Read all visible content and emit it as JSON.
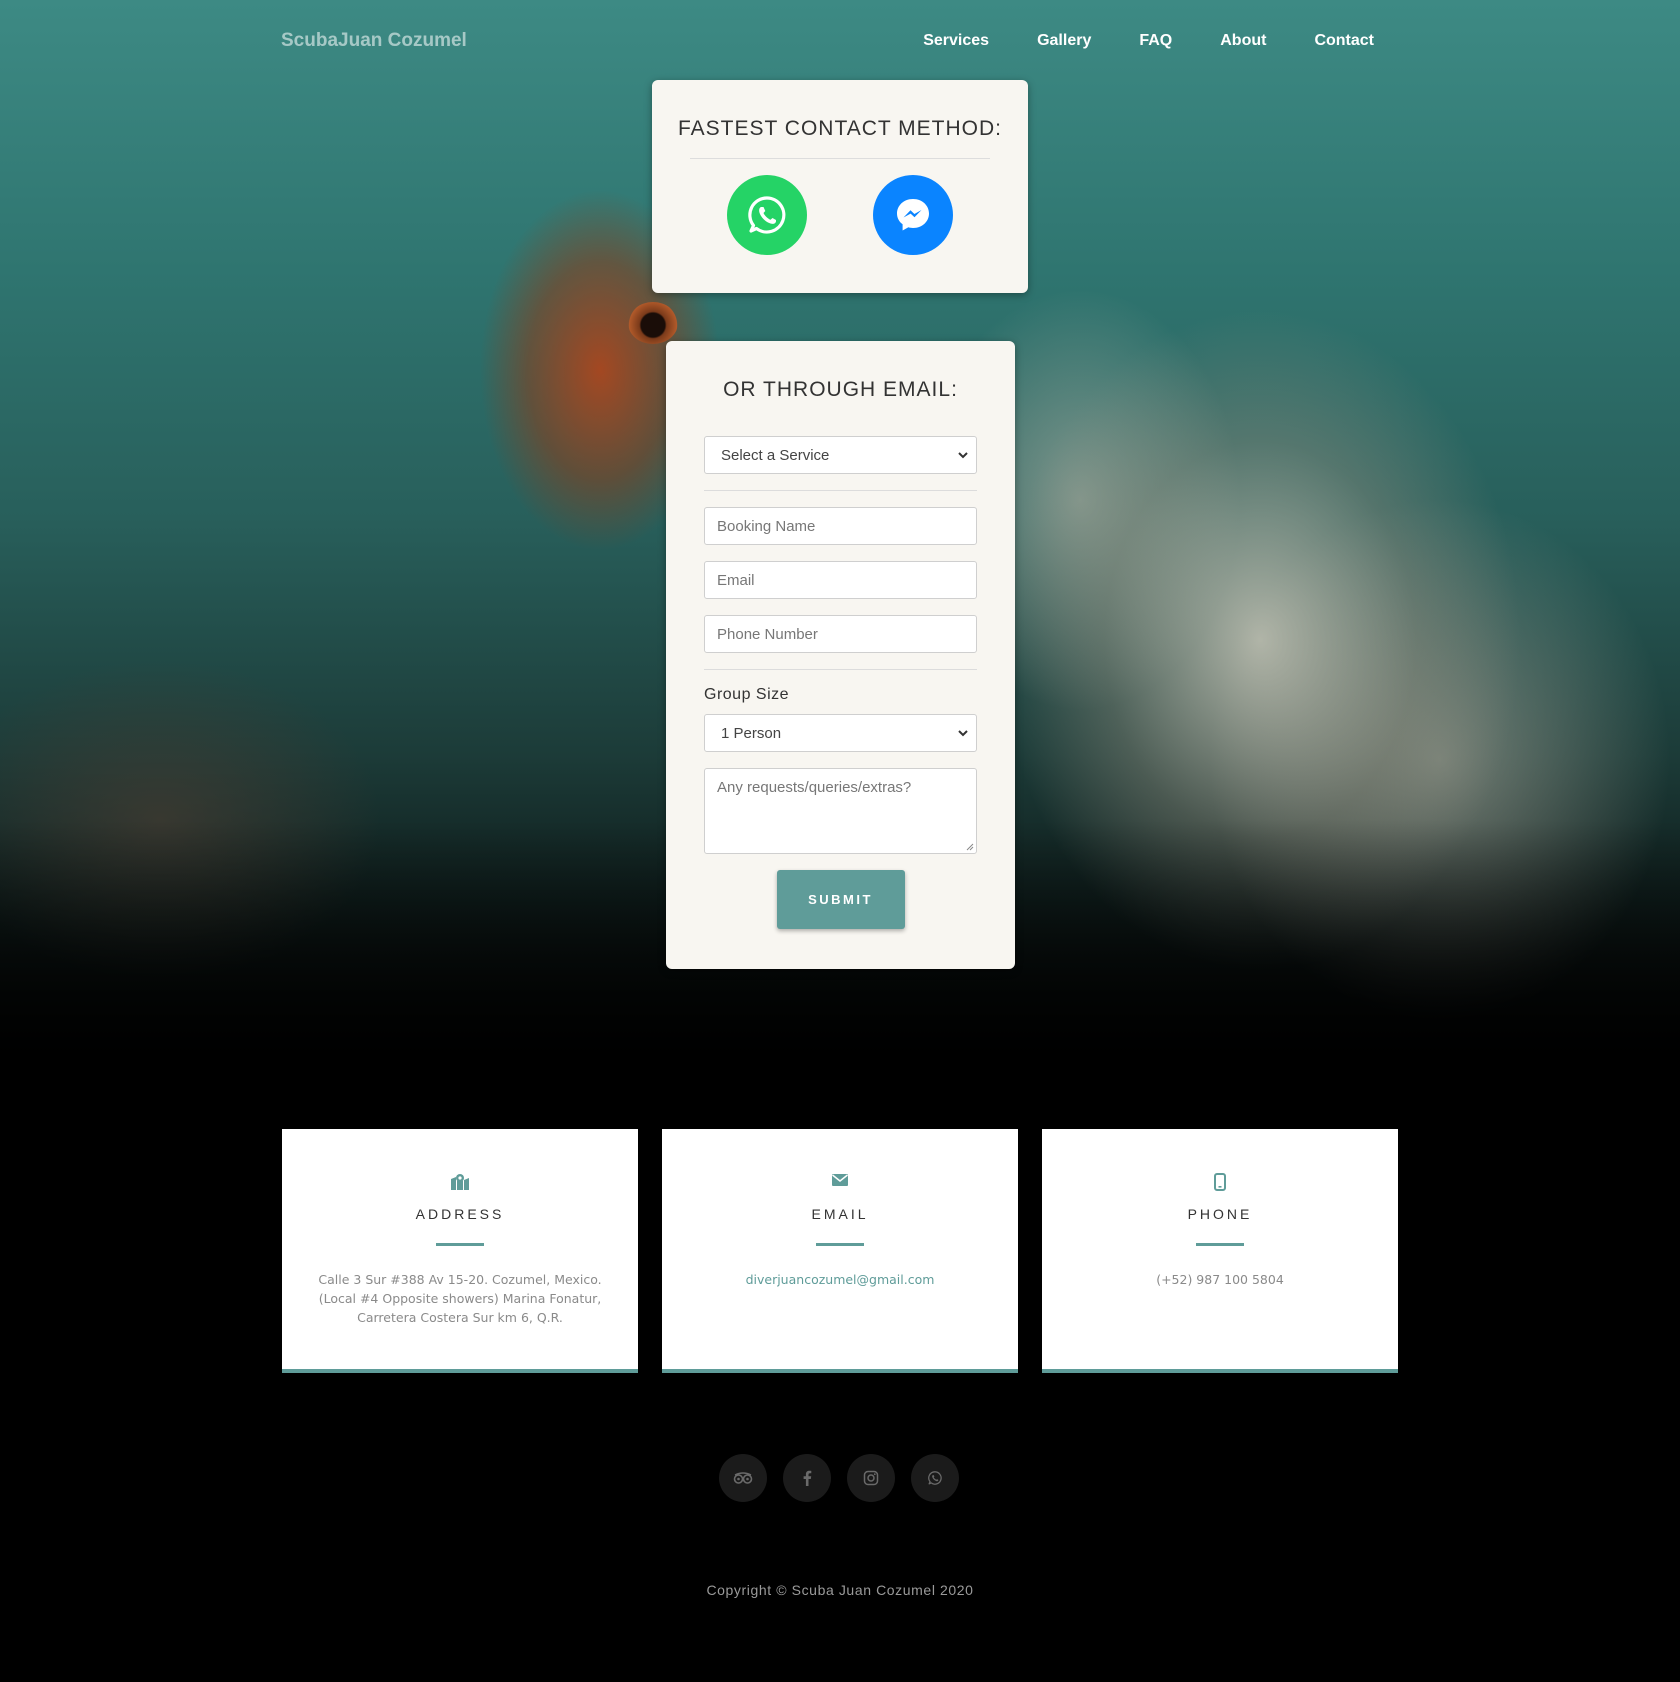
{
  "nav": {
    "brand": "ScubaJuan Cozumel",
    "links": [
      "Services",
      "Gallery",
      "FAQ",
      "About",
      "Contact"
    ]
  },
  "fastest": {
    "title": "FASTEST CONTACT METHOD:",
    "icons": [
      "whatsapp-icon",
      "messenger-icon"
    ]
  },
  "email_form": {
    "title": "OR THROUGH EMAIL:",
    "service_select": "Select a Service",
    "booking_name_placeholder": "Booking Name",
    "email_placeholder": "Email",
    "phone_placeholder": "Phone Number",
    "group_size_label": "Group Size",
    "group_size_value": "1 Person",
    "requests_placeholder": "Any requests/queries/extras?",
    "submit_label": "SUBMIT"
  },
  "info": {
    "address": {
      "icon": "map-icon",
      "heading": "ADDRESS",
      "text": "Calle 3 Sur #388 Av 15-20. Cozumel, Mexico. (Local #4 Opposite showers) Marina Fonatur, Carretera Costera Sur km 6, Q.R."
    },
    "email": {
      "icon": "envelope-icon",
      "heading": "EMAIL",
      "text": "diverjuancozumel@gmail.com"
    },
    "phone": {
      "icon": "mobile-phone-icon",
      "heading": "PHONE",
      "text": "(+52) 987 100 5804"
    }
  },
  "social": [
    "tripadvisor-icon",
    "facebook-icon",
    "instagram-icon",
    "whatsapp-icon"
  ],
  "footer": {
    "copyright": "Copyright © Scuba Juan Cozumel 2020"
  },
  "colors": {
    "accent": "#5f9c99",
    "whatsapp": "#25d366",
    "messenger": "#0a84ff",
    "card_bg": "#f8f6f1"
  }
}
